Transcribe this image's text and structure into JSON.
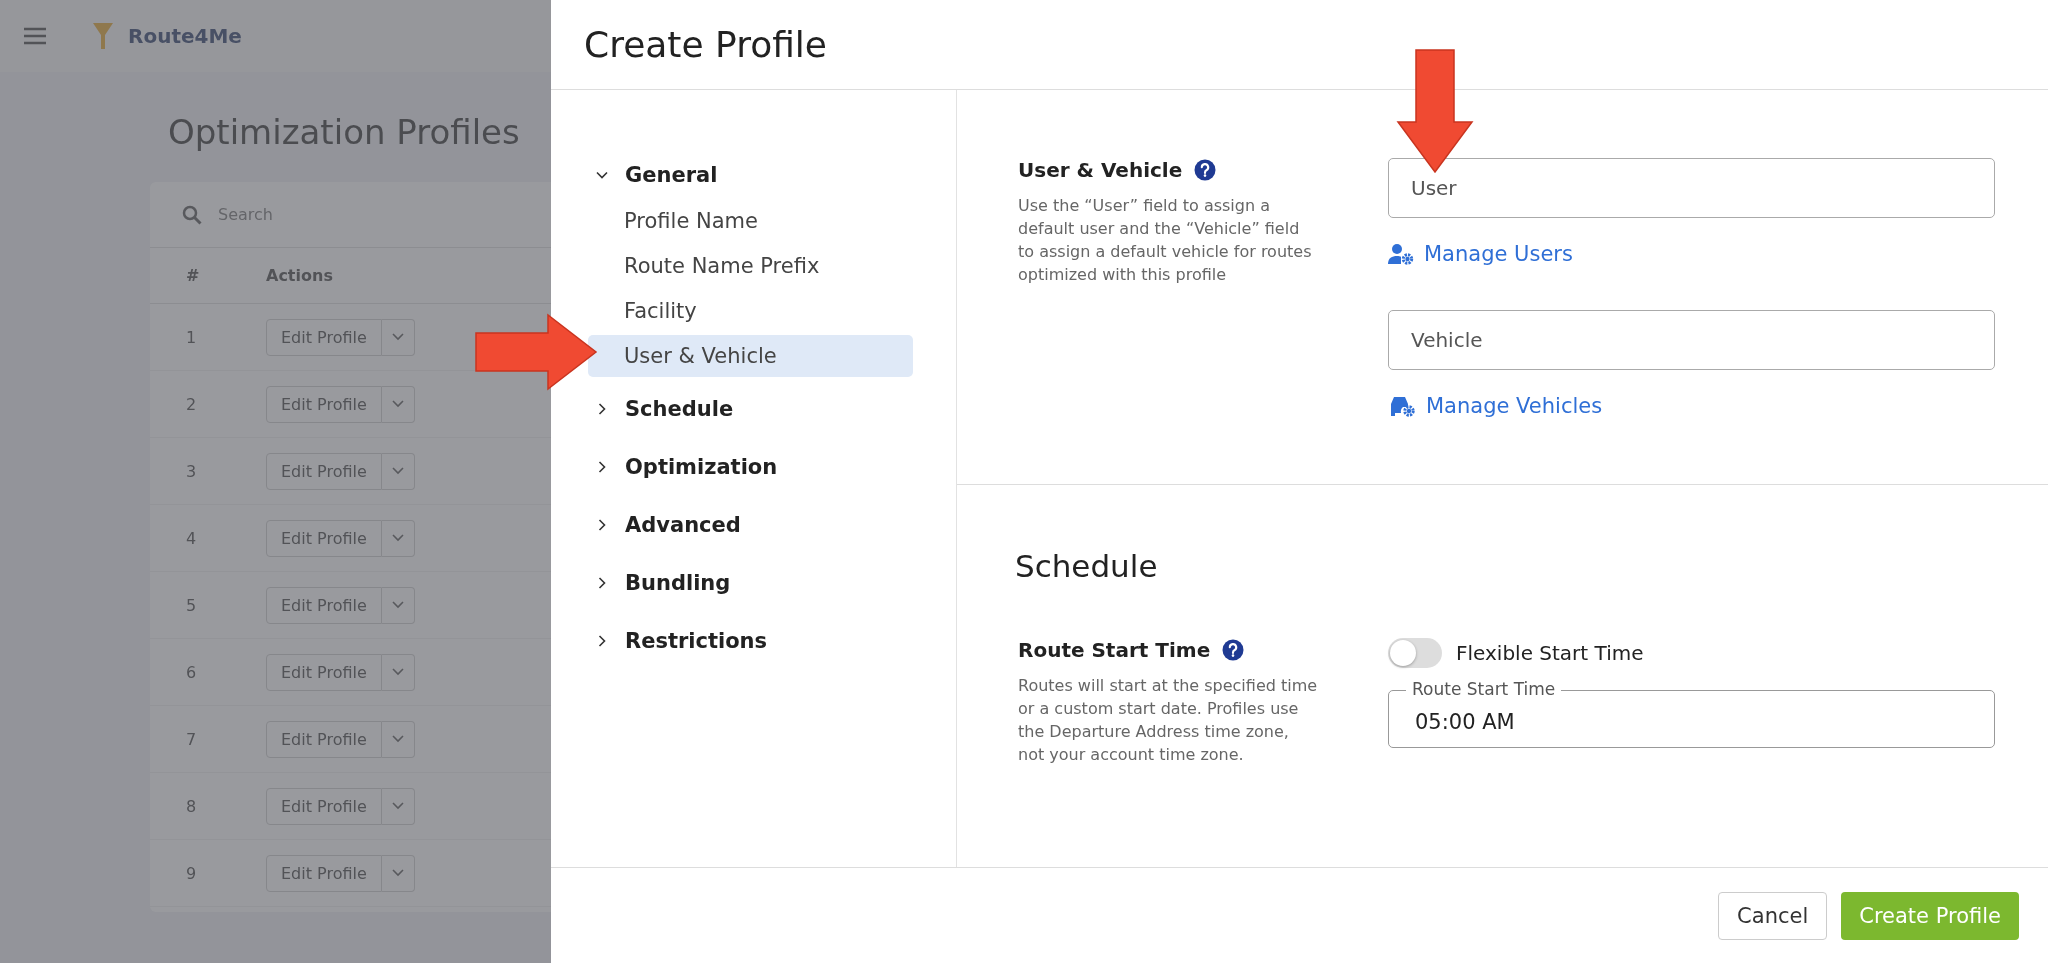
{
  "background_page": {
    "logo": "Route4Me",
    "title": "Optimization Profiles",
    "search": {
      "placeholder": "Search"
    },
    "columns": [
      "#",
      "Actions"
    ],
    "rows": [
      {
        "number": "1",
        "action": "Edit Profile"
      },
      {
        "number": "2",
        "action": "Edit Profile"
      },
      {
        "number": "3",
        "action": "Edit Profile"
      },
      {
        "number": "4",
        "action": "Edit Profile"
      },
      {
        "number": "5",
        "action": "Edit Profile"
      },
      {
        "number": "6",
        "action": "Edit Profile"
      },
      {
        "number": "7",
        "action": "Edit Profile"
      },
      {
        "number": "8",
        "action": "Edit Profile"
      },
      {
        "number": "9",
        "action": "Edit Profile"
      }
    ]
  },
  "dialog": {
    "title": "Create Profile",
    "nav": [
      {
        "label": "General",
        "expanded": true,
        "children": [
          {
            "label": "Profile Name",
            "selected": false
          },
          {
            "label": "Route Name Prefix",
            "selected": false
          },
          {
            "label": "Facility",
            "selected": false
          },
          {
            "label": "User & Vehicle",
            "selected": true
          }
        ]
      },
      {
        "label": "Schedule",
        "expanded": false
      },
      {
        "label": "Optimization",
        "expanded": false
      },
      {
        "label": "Advanced",
        "expanded": false
      },
      {
        "label": "Bundling",
        "expanded": false
      },
      {
        "label": "Restrictions",
        "expanded": false
      }
    ],
    "sections": [
      {
        "settings": [
          {
            "label": "User & Vehicle",
            "description": "Use the “User” field to assign a default user and the “Vehicle” field to assign a default vehicle for routes optimized with this profile",
            "controls": [
              {
                "kind": "input",
                "placeholder": "User"
              },
              {
                "kind": "link",
                "label": "Manage Users"
              },
              {
                "kind": "input",
                "placeholder": "Vehicle"
              },
              {
                "kind": "link",
                "label": "Manage Vehicles"
              }
            ]
          }
        ]
      },
      {
        "heading": "Schedule",
        "settings": [
          {
            "label": "Route Start Time",
            "description": "Routes will start at the specified time or a custom start date. Profiles use the Departure Address time zone, not your account time zone.",
            "controls": [
              {
                "kind": "toggle",
                "label": "Flexible Start Time",
                "on": false
              },
              {
                "kind": "time",
                "label": "Route Start Time",
                "value": "05:00 AM"
              }
            ]
          }
        ]
      }
    ],
    "buttons": [
      {
        "label": "Cancel",
        "kind": "secondary"
      },
      {
        "label": "Create Profile",
        "kind": "primary"
      }
    ]
  }
}
